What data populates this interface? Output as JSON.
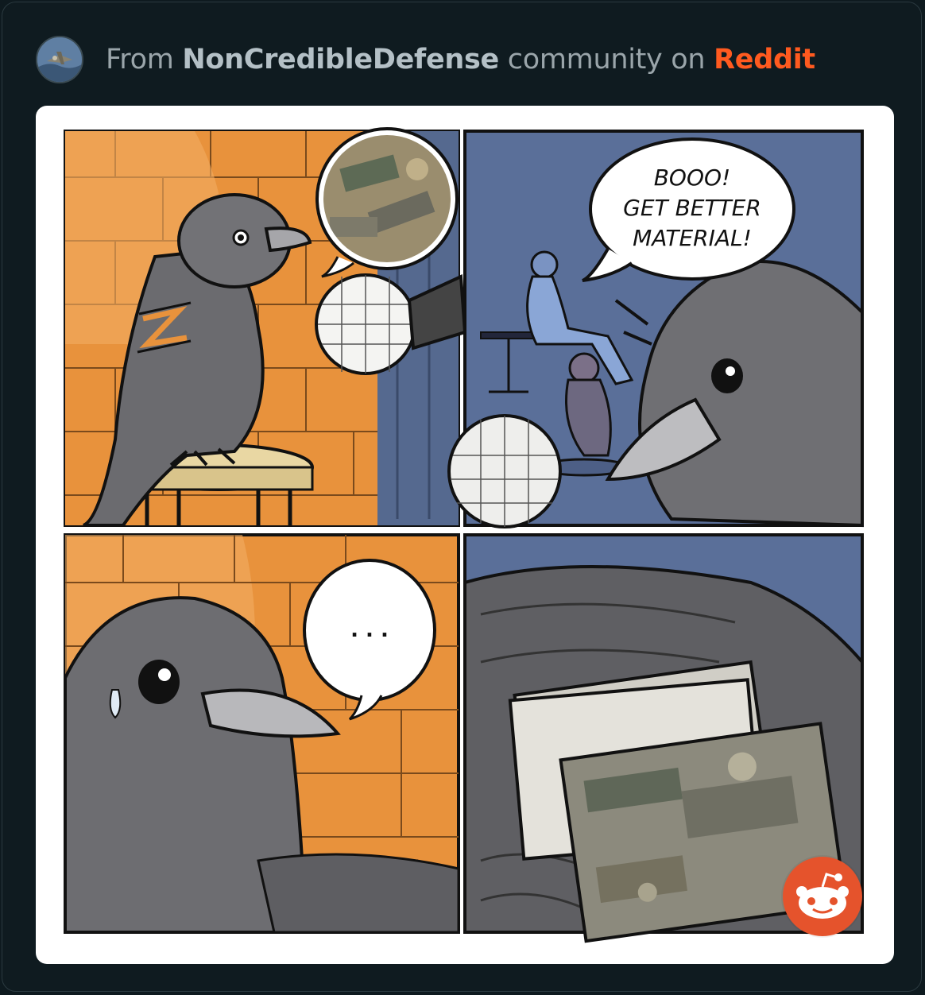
{
  "post": {
    "prefix": "From",
    "community": "NonCredibleDefense",
    "middle": "community on",
    "platform": "Reddit"
  },
  "comic": {
    "panel2_speech": [
      "BOOO!",
      "GET BETTER",
      "MATERIAL!"
    ],
    "panel3_speech": ". . ."
  },
  "icons": {
    "avatar": "community-avatar-icon",
    "badge": "reddit-logo-icon"
  },
  "colors": {
    "platform_accent": "#ff5a1f",
    "wall_orange": "#e8923c",
    "backdrop_blue": "#5a6f99"
  }
}
